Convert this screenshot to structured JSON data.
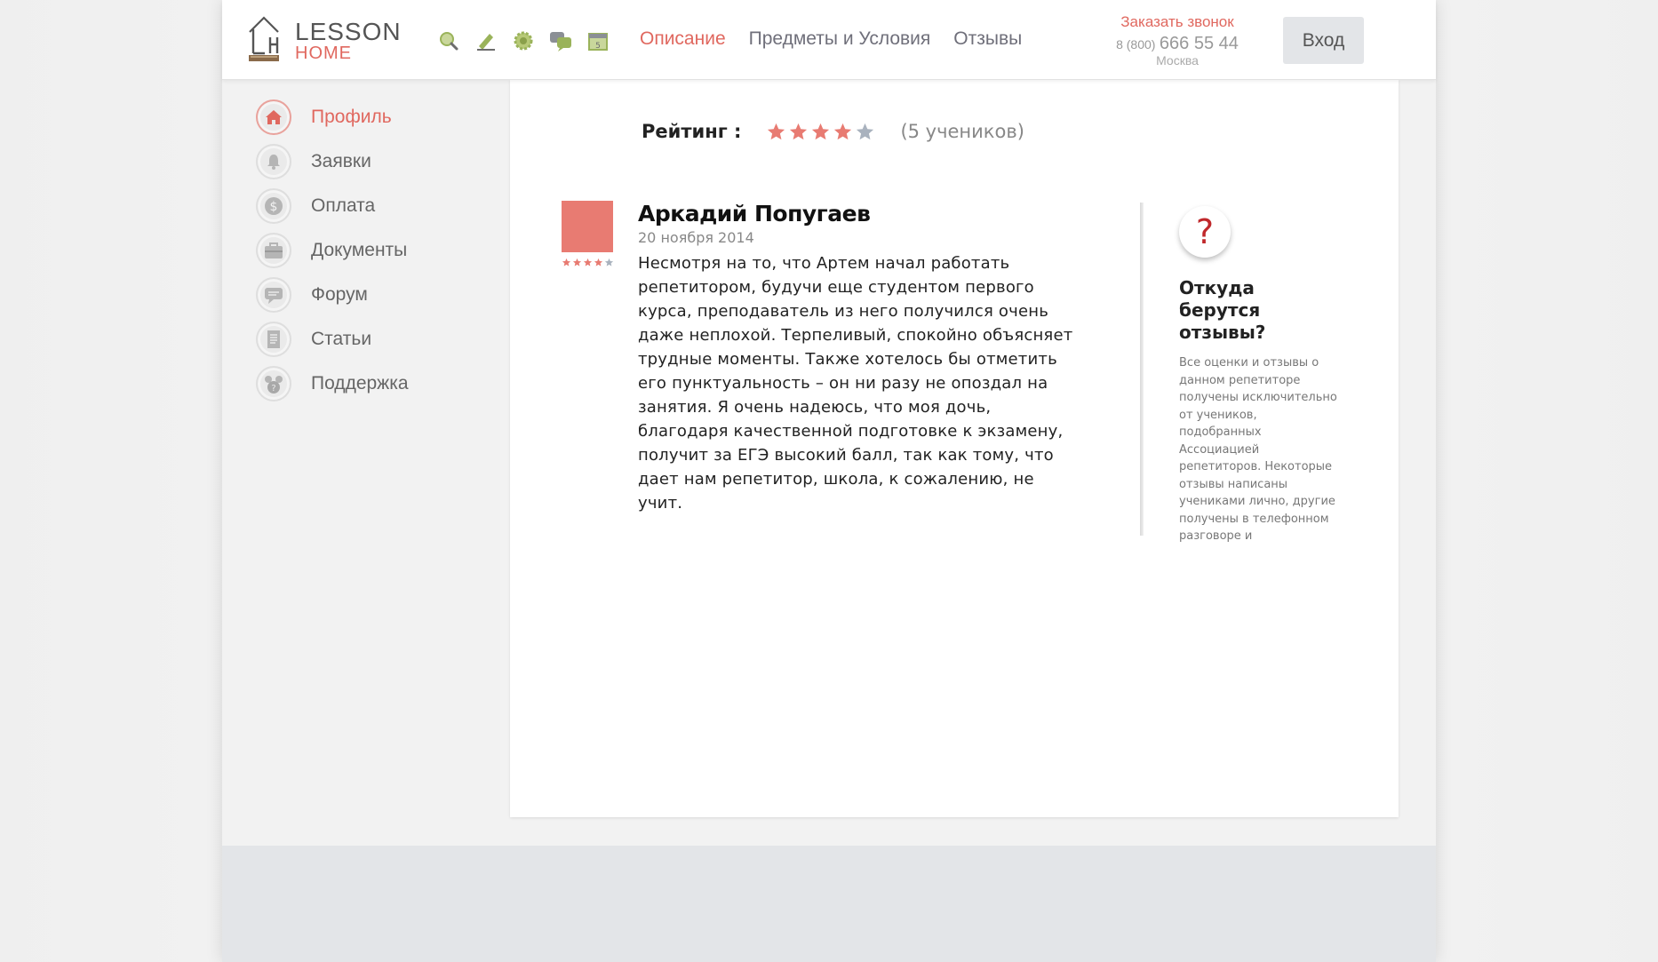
{
  "logo": {
    "line1": "LESSON",
    "line2": "HOME"
  },
  "toolbar": {
    "icons": [
      "search-icon",
      "pencil-icon",
      "gear-icon",
      "chat-icon",
      "calendar-icon"
    ]
  },
  "nav": {
    "items": [
      {
        "label": "Описание",
        "active": true
      },
      {
        "label": "Предметы и Условия",
        "active": false
      },
      {
        "label": "Отзывы",
        "active": false
      }
    ]
  },
  "contact": {
    "callback": "Заказать звонок",
    "phone_prefix": "8 (800)",
    "phone_number": "666 55 44",
    "city": "Москва"
  },
  "login": {
    "label": "Вход"
  },
  "sidebar": {
    "items": [
      {
        "label": "Профиль",
        "icon": "home-icon",
        "active": true
      },
      {
        "label": "Заявки",
        "icon": "bell-icon",
        "active": false
      },
      {
        "label": "Оплата",
        "icon": "dollar-icon",
        "active": false
      },
      {
        "label": "Документы",
        "icon": "briefcase-icon",
        "active": false
      },
      {
        "label": "Форум",
        "icon": "chat-bubble-icon",
        "active": false
      },
      {
        "label": "Статьи",
        "icon": "document-icon",
        "active": false
      },
      {
        "label": "Поддержка",
        "icon": "support-icon",
        "active": false
      }
    ]
  },
  "rating": {
    "label": "Рейтинг :",
    "stars": 4,
    "max_stars": 5,
    "count_text": "(5 учеников)"
  },
  "review": {
    "author": "Аркадий Попугаев",
    "date": "20 ноября 2014",
    "stars": 4,
    "max_stars": 5,
    "text": "Несмотря на то, что Артем начал работать репетитором, будучи еще студентом первого курса, преподаватель из него получился очень даже неплохой. Терпеливый, спокойно объясняет трудные моменты. Также хотелось бы отметить его пунктуальность – он ни разу не опоздал на занятия. Я очень надеюсь, что моя дочь, благодаря качественной подготовке к экзамену, получит за ЕГЭ высокий балл, так как тому, что дает нам репетитор, школа, к сожалению, не учит."
  },
  "info": {
    "symbol": "?",
    "title": "Откуда берутся отзывы?",
    "text": "Все оценки и отзывы о данном репетиторе получены исключительно от учеников, подобранных Ассоциацией репетиторов. Некоторые отзывы написаны учениками лично, другие получены в телефонном разговоре и"
  },
  "colors": {
    "accent": "#e0685f",
    "star_on": "#e87b72",
    "star_off": "#a9b2be",
    "icon_green": "#9ab35a"
  }
}
